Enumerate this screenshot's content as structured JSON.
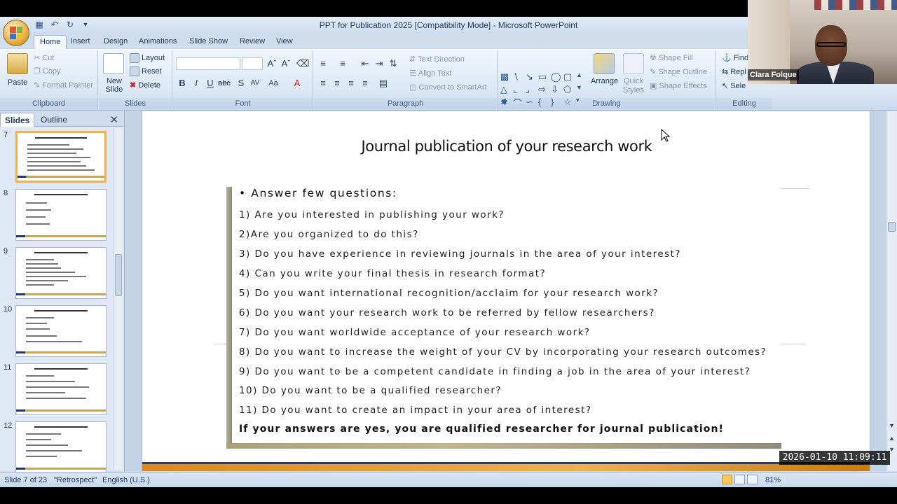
{
  "window": {
    "title": "PPT for Publication 2025 [Compatibility Mode] - Microsoft PowerPoint"
  },
  "ribbon": {
    "tabs": [
      "Home",
      "Insert",
      "Design",
      "Animations",
      "Slide Show",
      "Review",
      "View"
    ],
    "active_tab": "Home",
    "clipboard": {
      "paste": "Paste",
      "cut": "Cut",
      "copy": "Copy",
      "format_painter": "Format Painter",
      "label": "Clipboard"
    },
    "slides": {
      "new_slide": "New Slide",
      "layout": "Layout",
      "reset": "Reset",
      "delete": "Delete",
      "label": "Slides"
    },
    "font": {
      "label": "Font"
    },
    "paragraph": {
      "text_direction": "Text Direction",
      "align_text": "Align Text",
      "convert_smartart": "Convert to SmartArt",
      "label": "Paragraph"
    },
    "drawing": {
      "arrange": "Arrange",
      "quick_styles": "Quick Styles",
      "shape_fill": "Shape Fill",
      "shape_outline": "Shape Outline",
      "shape_effects": "Shape Effects",
      "label": "Drawing"
    },
    "editing": {
      "find": "Find",
      "replace": "Repl",
      "select": "Sele",
      "label": "Editing"
    }
  },
  "slides_pane": {
    "tabs": [
      "Slides",
      "Outline"
    ],
    "active_tab": "Slides",
    "thumbnails": [
      {
        "number": "7",
        "selected": true
      },
      {
        "number": "8",
        "selected": false
      },
      {
        "number": "9",
        "selected": false
      },
      {
        "number": "10",
        "selected": false
      },
      {
        "number": "11",
        "selected": false
      },
      {
        "number": "12",
        "selected": false
      }
    ]
  },
  "slide": {
    "title": "Journal publication of your research work",
    "bullet_heading": "Answer few questions:",
    "questions": [
      "1) Are you interested in publishing your work?",
      "2)Are you organized to do this?",
      "3) Do you have experience in reviewing journals in the area of your interest?",
      "4) Can you write your final thesis in research format?",
      "5) Do you want international recognition/acclaim for your research work?",
      "6) Do you want your research work to be referred by fellow researchers?",
      "7) Do you want worldwide acceptance of your research work?",
      "8) Do you want to increase the weight of your CV by incorporating your research outcomes?",
      "9) Do you want to be a competent candidate in finding a job in the area of your interest?",
      "10) Do you want to be a qualified researcher?",
      "11) Do you want to create an impact in your area of interest?"
    ],
    "conclusion": "If your answers are yes, you are qualified researcher for journal publication!"
  },
  "statusbar": {
    "slide_count": "Slide 7 of 23",
    "theme": "\"Retrospect\"",
    "language": "English (U.S.)",
    "zoom": "81%"
  },
  "overlay": {
    "timestamp": "2026-01-10 11:09:11",
    "participant_name": "Clara Folque"
  },
  "colors": {
    "ribbon_bg": "#dbe7f5",
    "selected_thumb": "#f0b347",
    "slide_footer": "#f1b04b"
  }
}
